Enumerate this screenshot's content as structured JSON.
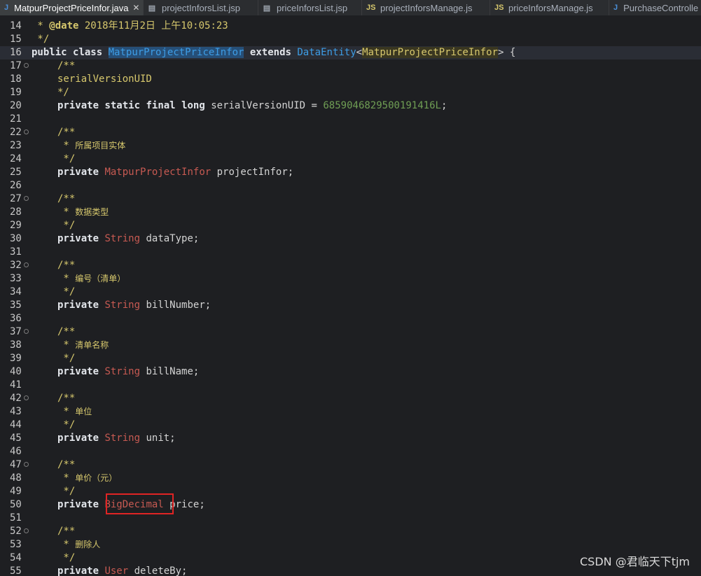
{
  "tabs": [
    {
      "icon": "J",
      "label": "MatpurProjectPriceInfor.java",
      "active": true,
      "close": "✕"
    },
    {
      "icon": "jsp",
      "label": "projectInforsList.jsp"
    },
    {
      "icon": "jsp",
      "label": "priceInforsList.jsp"
    },
    {
      "icon": "JS",
      "label": "projectInforsManage.js"
    },
    {
      "icon": "JS",
      "label": "priceInforsManage.js"
    },
    {
      "icon": "J",
      "label": "PurchaseControlle"
    }
  ],
  "code": {
    "l14": {
      "n": "14",
      "a": " * ",
      "tag": "@date",
      "b": " 2018年11月2日 上午10:05:23"
    },
    "l15": {
      "n": "15",
      "a": " */"
    },
    "l16": {
      "n": "16",
      "k1": "public",
      "k2": "class",
      "cls": "MatpurProjectPriceInfor",
      "k3": "extends",
      "sup": "DataEntity",
      "lt": "<",
      "gen": "MatpurProjectPriceInfor",
      "gt": ">",
      "br": " {"
    },
    "l17": {
      "n": "17",
      "c": "/**"
    },
    "l18": {
      "n": "18",
      "c": "serialVersionUID"
    },
    "l19": {
      "n": "19",
      "c": "*/"
    },
    "l20": {
      "n": "20",
      "k1": "private",
      "k2": "static",
      "k3": "final",
      "k4": "long",
      "v": "serialVersionUID = ",
      "num": "6859046829500191416L",
      "end": ";"
    },
    "l21": {
      "n": "21"
    },
    "l22": {
      "n": "22",
      "c": "/**"
    },
    "l23": {
      "n": "23",
      "c": " * ",
      "zh": "所属项目实体"
    },
    "l24": {
      "n": "24",
      "c": " */"
    },
    "l25": {
      "n": "25",
      "k": "private",
      "t": "MatpurProjectInfor",
      "v": " projectInfor;"
    },
    "l26": {
      "n": "26"
    },
    "l27": {
      "n": "27",
      "c": "/**"
    },
    "l28": {
      "n": "28",
      "c": " * ",
      "zh": "数据类型"
    },
    "l29": {
      "n": "29",
      "c": " */"
    },
    "l30": {
      "n": "30",
      "k": "private",
      "t": "String",
      "v": " dataType;"
    },
    "l31": {
      "n": "31"
    },
    "l32": {
      "n": "32",
      "c": "/**"
    },
    "l33": {
      "n": "33",
      "c": " * ",
      "zh": "编号（清单）"
    },
    "l34": {
      "n": "34",
      "c": " */"
    },
    "l35": {
      "n": "35",
      "k": "private",
      "t": "String",
      "v": " billNumber;"
    },
    "l36": {
      "n": "36"
    },
    "l37": {
      "n": "37",
      "c": "/**"
    },
    "l38": {
      "n": "38",
      "c": " * ",
      "zh": "清单名称"
    },
    "l39": {
      "n": "39",
      "c": " */"
    },
    "l40": {
      "n": "40",
      "k": "private",
      "t": "String",
      "v": " billName;"
    },
    "l41": {
      "n": "41"
    },
    "l42": {
      "n": "42",
      "c": "/**"
    },
    "l43": {
      "n": "43",
      "c": " * ",
      "zh": "单位"
    },
    "l44": {
      "n": "44",
      "c": " */"
    },
    "l45": {
      "n": "45",
      "k": "private",
      "t": "String",
      "v": " unit;"
    },
    "l46": {
      "n": "46"
    },
    "l47": {
      "n": "47",
      "c": "/**"
    },
    "l48": {
      "n": "48",
      "c": " * ",
      "zh": "单价（元）"
    },
    "l49": {
      "n": "49",
      "c": " */"
    },
    "l50": {
      "n": "50",
      "k": "private",
      "t": "BigDecimal",
      "v": " price;"
    },
    "l51": {
      "n": "51"
    },
    "l52": {
      "n": "52",
      "c": "/**"
    },
    "l53": {
      "n": "53",
      "c": " * ",
      "zh": "删除人"
    },
    "l54": {
      "n": "54",
      "c": " */"
    },
    "l55": {
      "n": "55",
      "k": "private",
      "t": "User",
      "v": " deleteBy;"
    }
  },
  "watermark": "CSDN @君临天下tjm",
  "colors": {
    "keyword": "#e3e6eb",
    "type": "#c75a52",
    "comment": "#d7c86d",
    "number": "#6f9e54",
    "classname": "#3d9de6",
    "highlight_box": "#e02424"
  }
}
